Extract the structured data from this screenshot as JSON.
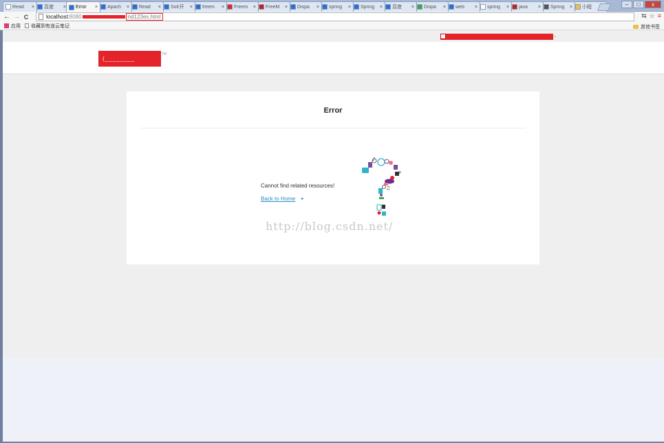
{
  "browser": {
    "tabs": [
      {
        "label": "Read",
        "fav_color": "#ffffff",
        "active": false
      },
      {
        "label": "百度",
        "fav_color": "#2b6fd6",
        "active": false
      },
      {
        "label": "Error",
        "fav_color": "#2b6fd6",
        "active": true
      },
      {
        "label": "Apach",
        "fav_color": "#2b6fd6",
        "active": false
      },
      {
        "label": "Read",
        "fav_color": "#2b6fd6",
        "active": false
      },
      {
        "label": "Solr开",
        "fav_color": "#2b6fd6",
        "active": false
      },
      {
        "label": "freem",
        "fav_color": "#2b6fd6",
        "active": false
      },
      {
        "label": "Freem",
        "fav_color": "#e4232a",
        "active": false
      },
      {
        "label": "FreeM",
        "fav_color": "#c9201c",
        "active": false
      },
      {
        "label": "Dispa",
        "fav_color": "#2b6fd6",
        "active": false
      },
      {
        "label": "spring",
        "fav_color": "#2b6fd6",
        "active": false
      },
      {
        "label": "Spring",
        "fav_color": "#2b6fd6",
        "active": false
      },
      {
        "label": "百度",
        "fav_color": "#2b6fd6",
        "active": false
      },
      {
        "label": "Dispa",
        "fav_color": "#3aa84a",
        "active": false
      },
      {
        "label": "web",
        "fav_color": "#2b6fd6",
        "active": false
      },
      {
        "label": "spring",
        "fav_color": "#ffffff",
        "active": false
      },
      {
        "label": "java",
        "fav_color": "#c9201c",
        "active": false
      },
      {
        "label": "Spring",
        "fav_color": "#555555",
        "active": false
      },
      {
        "label": "小程",
        "fav_color": "#e9c04a",
        "active": false
      }
    ],
    "tab_close": "×",
    "window_buttons": {
      "minimize": "–",
      "maximize": "□",
      "close": "x"
    },
    "nav": {
      "back": "←",
      "forward": "→",
      "reload": "C"
    },
    "url": {
      "host": "localhost:",
      "port": "8080",
      "path": "nd123ex.html"
    },
    "toolbar_icons": {
      "translate": "⇆",
      "star": "☆",
      "menu": "≡"
    },
    "bookmarks": {
      "apps": "应用",
      "item1": "收藏到有道云笔记",
      "other": "其他书签"
    }
  },
  "site": {
    "logo_text": "(________",
    "logo_tm": "TM",
    "topbar_caret": "⌄"
  },
  "error_page": {
    "title": "Error",
    "message": "Cannot find related resources!",
    "back_link": "Back to Home",
    "back_caret": "▸"
  },
  "watermark": "http://blog.csdn.net/",
  "colors": {
    "redaction": "#e4232a",
    "link": "#2e8bc9",
    "page_band": "#efefef",
    "page_bottom": "#eef1f8"
  }
}
